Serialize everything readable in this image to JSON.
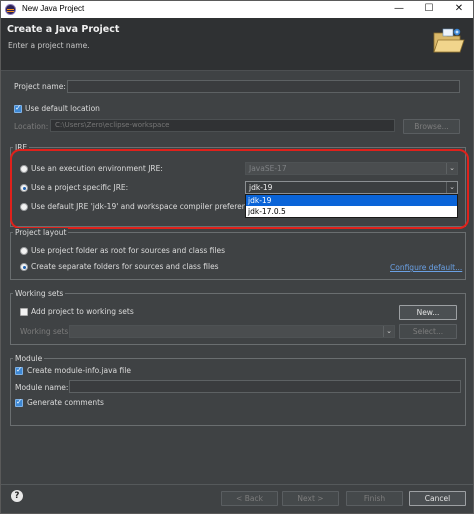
{
  "window": {
    "title": "New Java Project",
    "minimize": "—",
    "maximize": "☐",
    "close": "✕"
  },
  "header": {
    "title": "Create a Java Project",
    "subtitle": "Enter a project name."
  },
  "project": {
    "name_label": "Project name:",
    "name_value": "",
    "use_default_location_label": "Use default location",
    "use_default_location_checked": true,
    "location_label": "Location:",
    "location_value": "C:\\Users\\Zero\\eclipse-workspace",
    "browse_label": "Browse..."
  },
  "jre": {
    "group_label": "JRE",
    "option_env_label": "Use an execution environment JRE:",
    "env_value": "JavaSE-17",
    "option_specific_label": "Use a project specific JRE:",
    "specific_value": "jdk-19",
    "option_default_label": "Use default JRE 'jdk-19' and workspace compiler preferences",
    "selected_option": "specific",
    "dropdown_options": [
      "jdk-19",
      "jdk-17.0.5"
    ],
    "dropdown_selected": "jdk-19"
  },
  "layout": {
    "group_label": "Project layout",
    "option_root_label": "Use project folder as root for sources and class files",
    "option_separate_label": "Create separate folders for sources and class files",
    "configure_link": "Configure default..."
  },
  "working_sets": {
    "group_label": "Working sets",
    "add_label": "Add project to working sets",
    "add_checked": false,
    "new_label": "New...",
    "sets_label": "Working sets:",
    "select_label": "Select..."
  },
  "module": {
    "group_label": "Module",
    "create_label": "Create module-info.java file",
    "create_checked": true,
    "name_label": "Module name:",
    "generate_label": "Generate comments",
    "generate_checked": true
  },
  "footer": {
    "help_icon": "?",
    "back_label": "< Back",
    "next_label": "Next >",
    "finish_label": "Finish",
    "cancel_label": "Cancel"
  },
  "colors": {
    "dialog_bg": "#3f4244",
    "header_bg": "#2f3133",
    "highlight_border": "#e0211b",
    "selection": "#0a64d8",
    "checkbox_accent": "#3e88d4",
    "link": "#6aa0e4"
  }
}
